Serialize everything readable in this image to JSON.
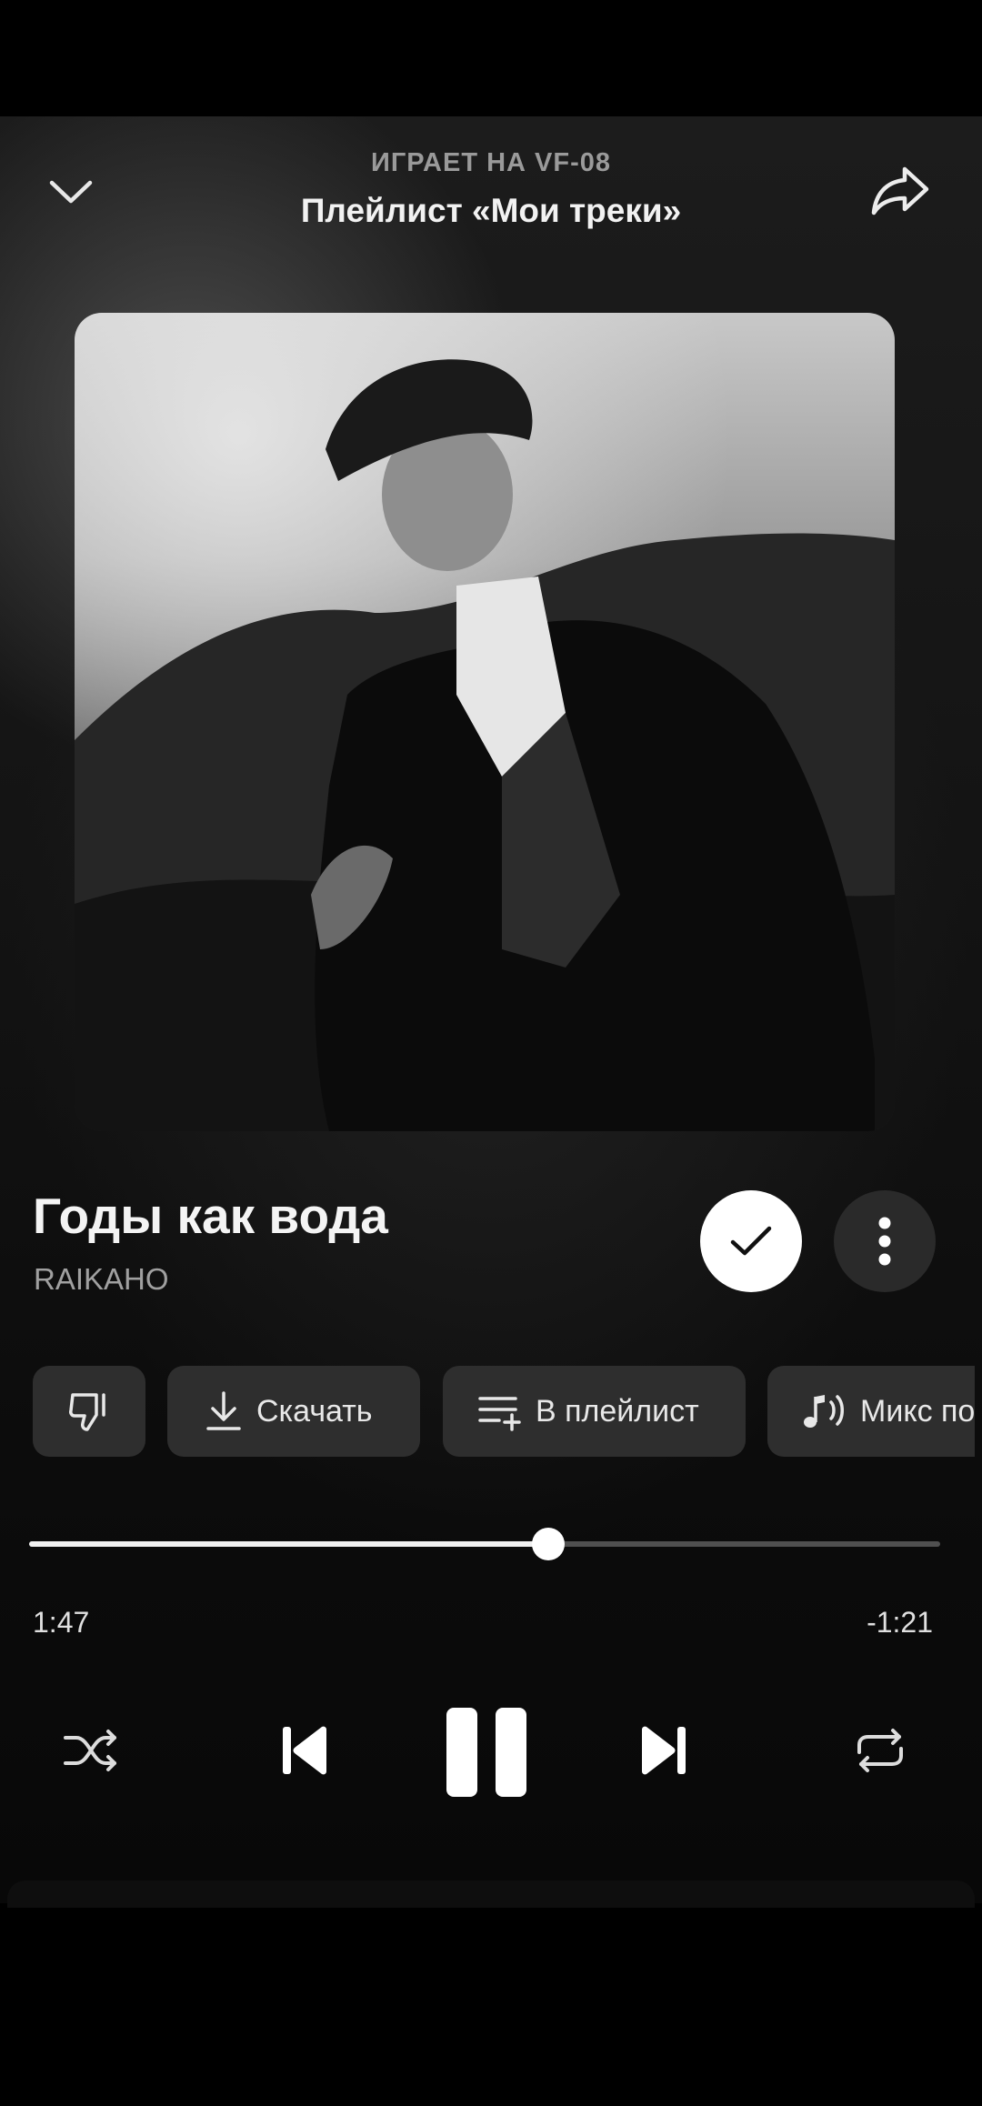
{
  "header": {
    "playing_on": "ИГРАЕТ НА VF-08",
    "playlist": "Плейлист «Мои треки»"
  },
  "track": {
    "title": "Годы как вода",
    "artist": "RAIKAHO"
  },
  "actions": {
    "download": "Скачать",
    "add_to_playlist": "В плейлист",
    "mix": "Микс по"
  },
  "playback": {
    "elapsed": "1:47",
    "remaining": "-1:21",
    "progress_fraction": 0.57,
    "state": "playing"
  },
  "icons": {
    "collapse": "chevron-down-icon",
    "share": "share-icon",
    "like": "check-icon",
    "more": "more-vertical-icon",
    "dislike": "thumbs-down-icon",
    "download": "download-icon",
    "playlist": "playlist-add-icon",
    "mix": "music-mix-icon",
    "shuffle": "shuffle-icon",
    "prev": "skip-previous-icon",
    "pause": "pause-icon",
    "next": "skip-next-icon",
    "repeat": "repeat-icon"
  },
  "colors": {
    "background": "#000000",
    "surface": "#2e2e2e",
    "accent": "#ffffff",
    "secondary_text": "#a0a0a0"
  }
}
